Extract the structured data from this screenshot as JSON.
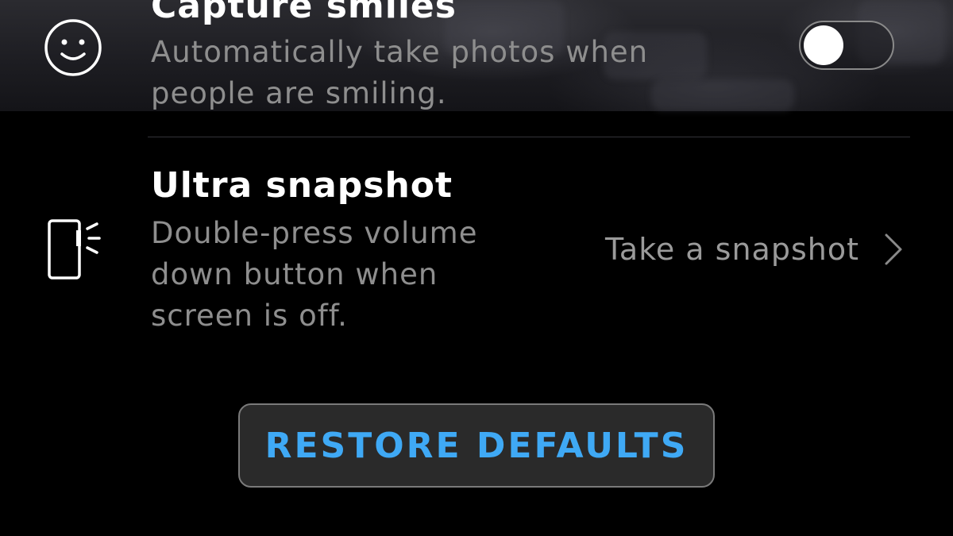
{
  "settings": {
    "capture_smiles": {
      "icon": "smiley-face-icon",
      "title": "Capture smiles",
      "description_lines": [
        "Automatically take photos when",
        "people are smiling."
      ],
      "enabled": false
    },
    "ultra_snapshot": {
      "icon": "phone-volume-button-icon",
      "title": "Ultra snapshot",
      "description_lines": [
        "Double-press volume",
        "down button when",
        "screen is off."
      ],
      "value": "Take a snapshot",
      "value_icon": "chevron-right-icon"
    }
  },
  "footer": {
    "restore_label": "RESTORE DEFAULTS"
  },
  "colors": {
    "background": "#000000",
    "title_text": "#ffffff",
    "secondary_text": "#8e8e8e",
    "accent": "#3fa9f5",
    "button_bg": "#2a2a2a"
  }
}
